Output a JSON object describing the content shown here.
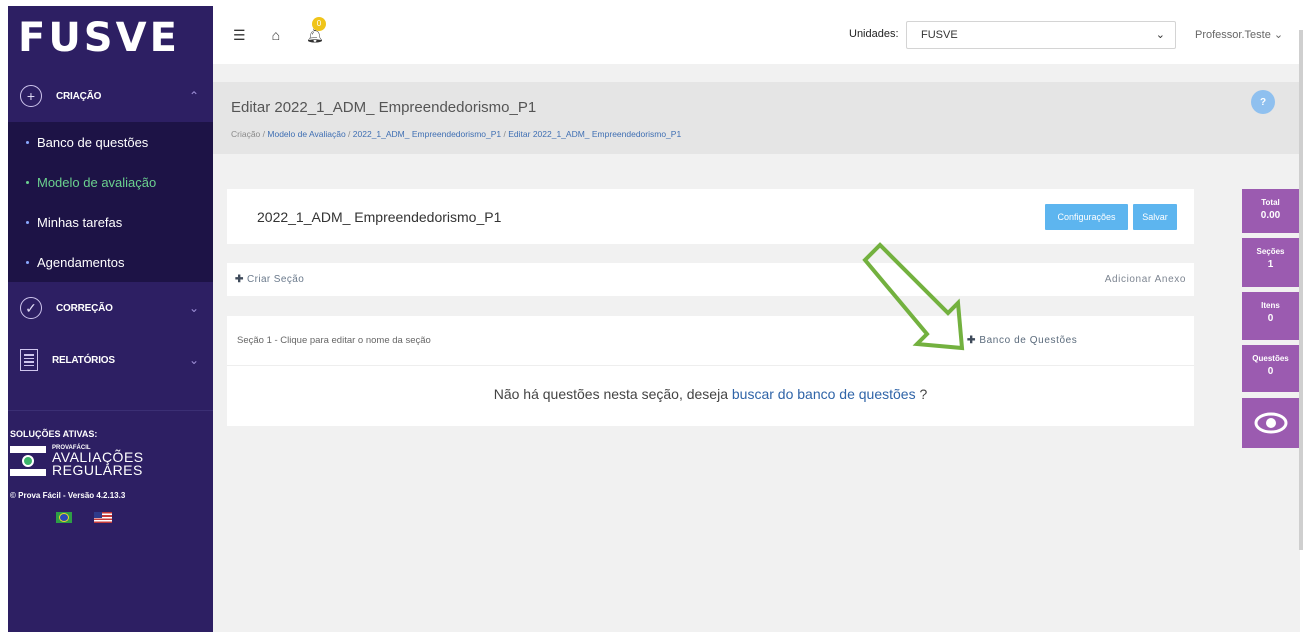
{
  "logo": "FUSVE",
  "sidebar": {
    "criacao": "CRIAÇÃO",
    "items": [
      {
        "label": "Banco de questões"
      },
      {
        "label": "Modelo de avaliação"
      },
      {
        "label": "Minhas tarefas"
      },
      {
        "label": "Agendamentos"
      }
    ],
    "correcao": "CORREÇÃO",
    "relatorios": "RELATÓRIOS",
    "solutions_title": "SOLUÇÕES ATIVAS:",
    "brand_small": "PROVAFÁCIL",
    "brand_line1": "AVALIAÇÕES",
    "brand_line2": "REGULARES",
    "version": "© Prova Fácil - Versão 4.2.13.3"
  },
  "topbar": {
    "notification_count": "0",
    "units_label": "Unidades:",
    "units_value": "FUSVE",
    "user": "Professor.Teste"
  },
  "header": {
    "title": "Editar 2022_1_ADM_ Empreendedorismo_P1",
    "crumb_root": "Criação",
    "crumb_1": "Modelo de Avaliação",
    "crumb_2": "2022_1_ADM_ Empreendedorismo_P1",
    "crumb_3": "Editar 2022_1_ADM_ Empreendedorismo_P1",
    "help": "?"
  },
  "model": {
    "title": "2022_1_ADM_ Empreendedorismo_P1",
    "config_label": "Configurações",
    "save_label": "Salvar"
  },
  "actions": {
    "create_section": "Criar Seção",
    "add_attachment": "Adicionar Anexo"
  },
  "section": {
    "name": "Seção 1 - Clique para editar o nome da seção",
    "bank_label": "Banco de Questões",
    "empty_text": "Não há questões nesta seção, deseja",
    "empty_link": "buscar do banco de questões",
    "empty_end": "?"
  },
  "stats": {
    "total_label": "Total",
    "total_value": "0.00",
    "secoes_label": "Seções",
    "secoes_value": "1",
    "itens_label": "Itens",
    "itens_value": "0",
    "questoes_label": "Questões",
    "questoes_value": "0"
  },
  "colors": {
    "sidebar": "#2d1f63",
    "accent_green": "#6bd18f",
    "button_blue": "#5db5ef",
    "stat_purple": "#9b5bb0",
    "arrow_green": "#73b13f"
  }
}
